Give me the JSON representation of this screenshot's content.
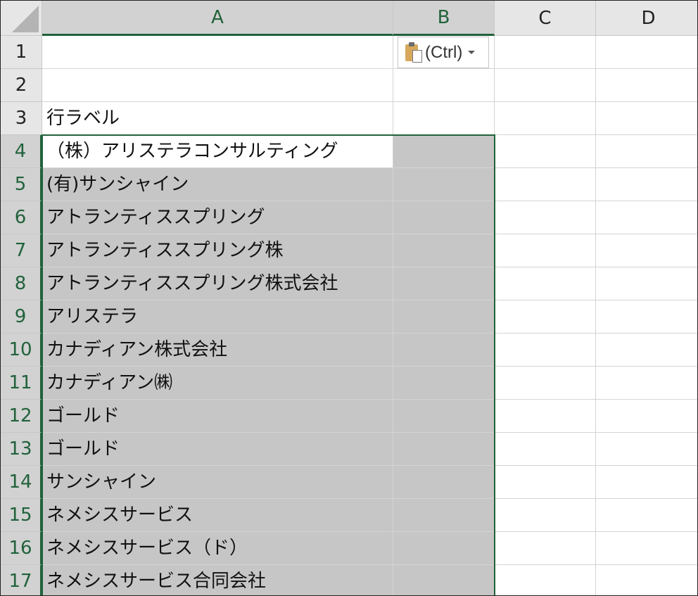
{
  "columns": [
    "A",
    "B",
    "C",
    "D"
  ],
  "rows": [
    {
      "num": "1",
      "a": ""
    },
    {
      "num": "2",
      "a": ""
    },
    {
      "num": "3",
      "a": "行ラベル"
    },
    {
      "num": "4",
      "a": "（株）アリステラコンサルティング"
    },
    {
      "num": "5",
      "a": "(有)サンシャイン"
    },
    {
      "num": "6",
      "a": "アトランティススプリング"
    },
    {
      "num": "7",
      "a": "アトランティススプリング株"
    },
    {
      "num": "8",
      "a": "アトランティススプリング株式会社"
    },
    {
      "num": "9",
      "a": "アリステラ"
    },
    {
      "num": "10",
      "a": "カナディアン株式会社"
    },
    {
      "num": "11",
      "a": "カナディアン㈱"
    },
    {
      "num": "12",
      "a": "ゴールド"
    },
    {
      "num": "13",
      "a": "ゴールド"
    },
    {
      "num": "14",
      "a": "サンシャイン"
    },
    {
      "num": "15",
      "a": "ネメシスサービス"
    },
    {
      "num": "16",
      "a": "ネメシスサービス（ド）"
    },
    {
      "num": "17",
      "a": "ネメシスサービス合同会社"
    }
  ],
  "paste_options": {
    "label": "(Ctrl)",
    "icon": "clipboard-paste-icon"
  },
  "selection": {
    "range": "A4:B17",
    "active_cell": "A4"
  },
  "colors": {
    "accent": "#21623b",
    "selection_fill": "#c6c6c6",
    "header_bg": "#e6e6e6"
  }
}
